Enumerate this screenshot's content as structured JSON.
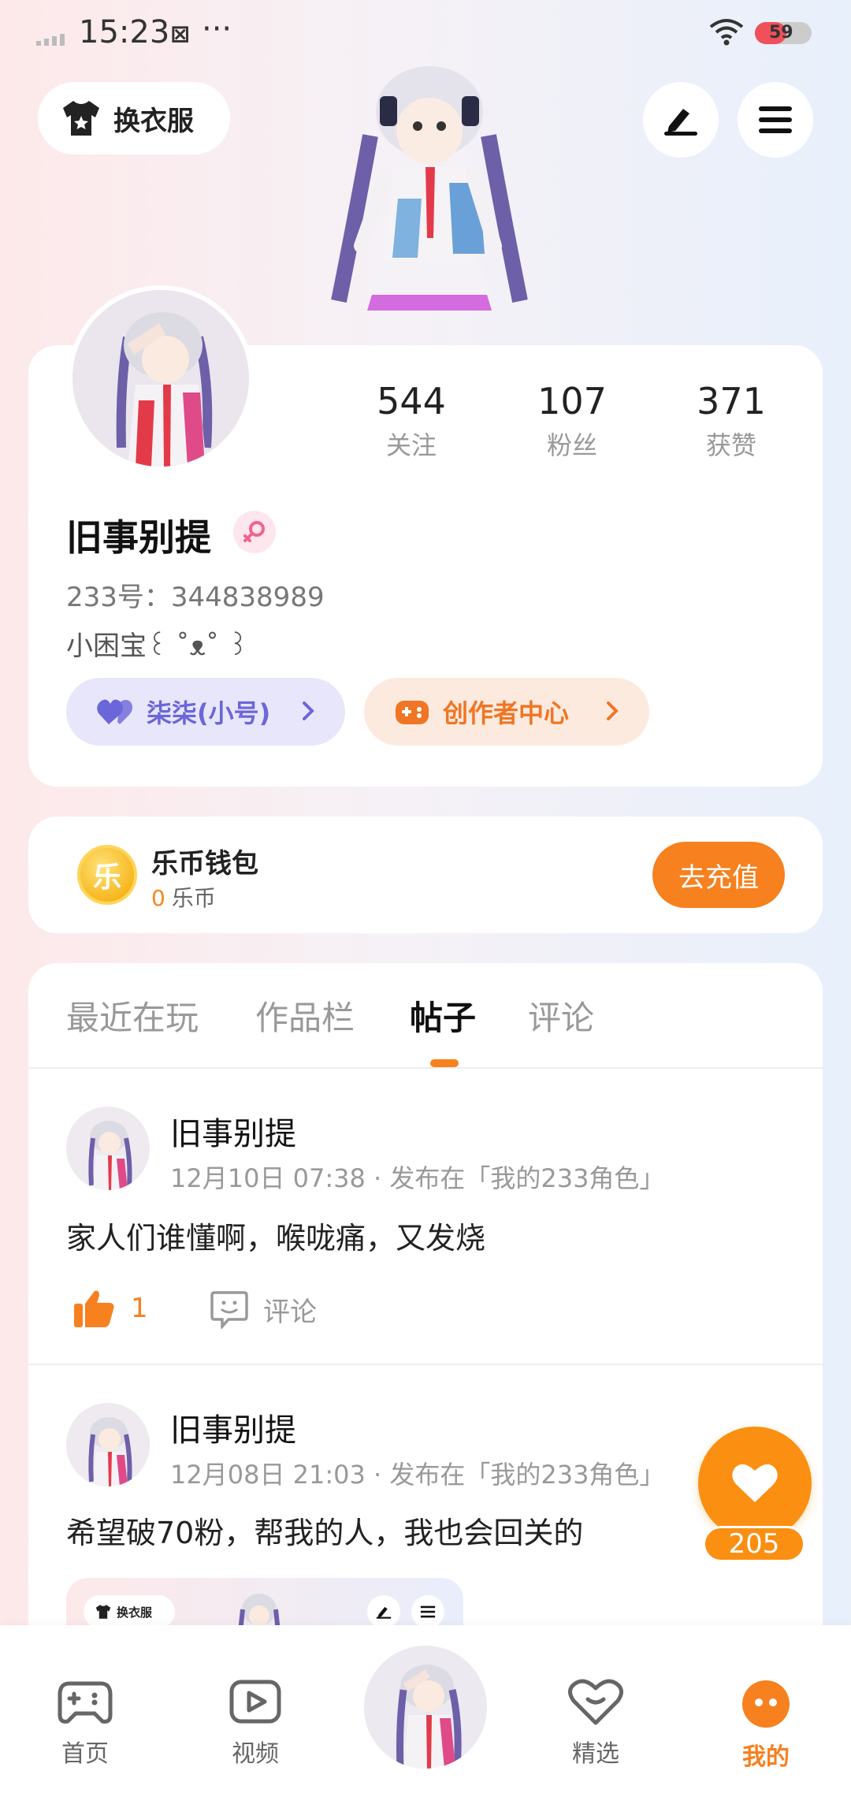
{
  "status_bar": {
    "time": "15:23",
    "battery": "59"
  },
  "header": {
    "dress_label": "换衣服"
  },
  "profile": {
    "stats": [
      {
        "value": "544",
        "label": "关注"
      },
      {
        "value": "107",
        "label": "粉丝"
      },
      {
        "value": "371",
        "label": "获赞"
      }
    ],
    "username": "旧事别提",
    "user_id": "233号：344838989",
    "bio": "小困宝꒰ ˚ᴥ˚ ꒱",
    "alt_account_label": "柒柒(小号)",
    "creator_center_label": "创作者中心"
  },
  "wallet": {
    "title": "乐币钱包",
    "coin_glyph": "乐",
    "balance": "0",
    "unit": "乐币",
    "recharge_label": "去充值"
  },
  "tabs": [
    "最近在玩",
    "作品栏",
    "帖子",
    "评论"
  ],
  "active_tab": "帖子",
  "posts": [
    {
      "author": "旧事别提",
      "meta": "12月10日 07:38 · 发布在「我的233角色」",
      "body": "家人们谁懂啊，喉咙痛，又发烧",
      "likes": "1",
      "comment_label": "评论"
    },
    {
      "author": "旧事别提",
      "meta": "12月08日 21:03 · 发布在「我的233角色」",
      "body": "希望破70粉，帮我的人，我也会回关的",
      "image_dress_label": "换衣服"
    }
  ],
  "floating": {
    "count": "205"
  },
  "bottom_nav": [
    {
      "label": "首页",
      "icon": "gamepad-icon"
    },
    {
      "label": "视频",
      "icon": "video-play-icon"
    },
    {
      "label": "",
      "icon": "character-avatar"
    },
    {
      "label": "精选",
      "icon": "heart-smile-icon"
    },
    {
      "label": "我的",
      "icon": "face-icon"
    }
  ],
  "colors": {
    "accent": "#f7801f",
    "alt_purple": "#6b66d9",
    "pink": "#f2648c"
  }
}
